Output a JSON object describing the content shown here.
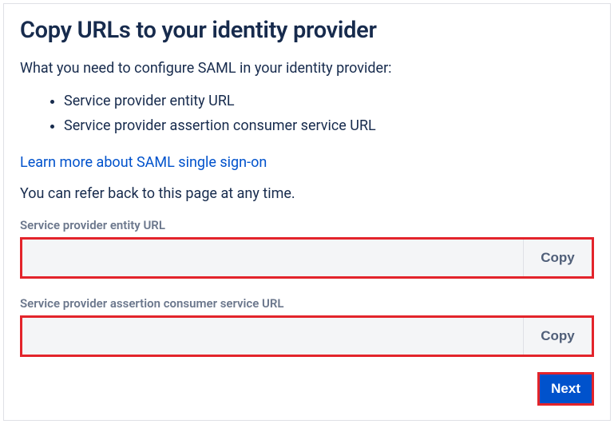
{
  "title": "Copy URLs to your identity provider",
  "intro": "What you need to configure SAML in your identity provider:",
  "bullets": [
    "Service provider entity URL",
    "Service provider assertion consumer service URL"
  ],
  "learn_more": "Learn more about SAML single sign-on",
  "refer_note": "You can refer back to this page at any time.",
  "fields": {
    "entity": {
      "label": "Service provider entity URL",
      "value": "",
      "copy_label": "Copy"
    },
    "acs": {
      "label": "Service provider assertion consumer service URL",
      "value": "",
      "copy_label": "Copy"
    }
  },
  "next_label": "Next"
}
